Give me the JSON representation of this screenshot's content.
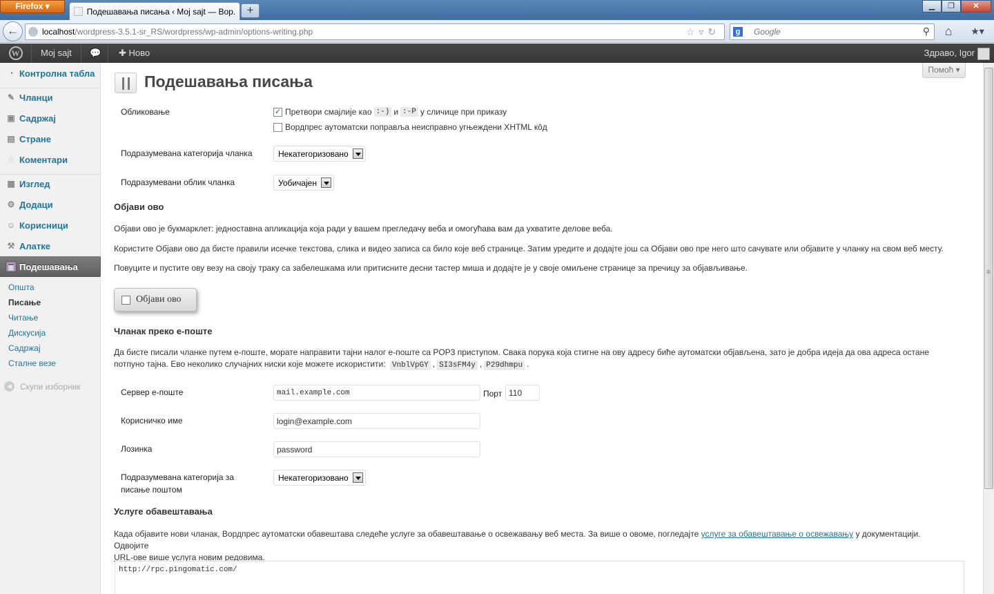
{
  "browser": {
    "app_button": "Firefox",
    "tab_title": "Подешавања писања ‹ Мој sajt — Вор...",
    "url_host": "localhost",
    "url_path": "/wordpress-3.5.1-sr_RS/wordpress/wp-admin/options-writing.php",
    "search_placeholder": "Google",
    "search_engine_letter": "g"
  },
  "adminbar": {
    "site_name": "Moj sajt",
    "new_label": "Ново",
    "howdy": "Здраво, Igor"
  },
  "sidebar": {
    "items": [
      {
        "label": "Контролна табла",
        "icon": "dashboard-icon"
      },
      {
        "label": "Чланци",
        "icon": "pin-icon"
      },
      {
        "label": "Садржај",
        "icon": "media-icon"
      },
      {
        "label": "Стране",
        "icon": "pages-icon"
      },
      {
        "label": "Коментари",
        "icon": "comment-icon"
      },
      {
        "label": "Изглед",
        "icon": "appearance-icon"
      },
      {
        "label": "Додаци",
        "icon": "plugin-icon"
      },
      {
        "label": "Корисници",
        "icon": "users-icon"
      },
      {
        "label": "Алатке",
        "icon": "tools-icon"
      },
      {
        "label": "Подешавања",
        "icon": "settings-icon"
      }
    ],
    "submenu": [
      "Општа",
      "Писање",
      "Читање",
      "Дискусија",
      "Садржај",
      "Сталне везе"
    ],
    "collapse": "Скупи изборник"
  },
  "page": {
    "help": "Помоћ",
    "title": "Подешавања писања",
    "formatting": {
      "label": "Обликовање",
      "smilies_a": "Претвори смајлије као",
      "smilies_code1": ":-)",
      "smilies_and": "и",
      "smilies_code2": ":-P",
      "smilies_b": "у сличице при приказу",
      "smilies_checked": true,
      "xhtml": "Вордпрес аутоматски поправља неисправно угњеждени XHTML кôд",
      "xhtml_checked": false
    },
    "default_category": {
      "label": "Подразумевана категорија чланка",
      "value": "Некатегоризовано"
    },
    "default_format": {
      "label": "Подразумевани облик чланка",
      "value": "Уобичајен"
    },
    "press_this": {
      "heading": "Објави ово",
      "p1": "Објави ово је букмарклет: једноставна апликација која ради у вашем прегледачу веба и омогућава вам да ухватите делове веба.",
      "p2": "Користите Објави ово да бисте правили исечке текстова, слика и видео записа са било које веб странице. Затим уредите и додајте још са Објави ово пре него што сачувате или објавите у чланку на свом веб месту.",
      "p3": "Повуците и пустите ову везу на своју траку са забелешкама или притисните десни тастер миша и додајте је у своје омиљене странице за пречицу за објављивање.",
      "button": "Објави ово"
    },
    "post_via_email": {
      "heading": "Чланак преко е-поште",
      "p_line1": "Да бисте писали чланке путем е-поште, морате направити тајни налог е-поште са POP3 приступом. Свака порука која стигне на ову адресу биће аутоматски објављена, зато је добра идеја да ова адреса остане",
      "p_line2": "потпуно тајна. Ево неколико случајних ниски које можете искористити:",
      "codes": [
        "VnblVpGY",
        "SI3sFM4y",
        "P29dhmpu"
      ],
      "server_label": "Сервер е-поште",
      "server_value": "mail.example.com",
      "port_label": "Порт",
      "port_value": "110",
      "login_label": "Корисничко име",
      "login_value": "login@example.com",
      "password_label": "Лозинка",
      "password_value": "password",
      "category_label_1": "Подразумевана категорија за",
      "category_label_2": "писање поштом",
      "category_value": "Некатегоризовано"
    },
    "update_services": {
      "heading": "Услуге обавештавања",
      "p_a": "Када објавите нови чланак, Вордпрес аутоматски обавештава следеће услуге за обавештавање о освежавању веб места. За више о овоме, погледајте",
      "p_link": "услуге за обавештавање о освежавању",
      "p_b": "у документацији. Одвојите",
      "p_c_abbr": "URL",
      "p_c": "-ове више услуга новим редовима.",
      "ping_sites": "http://rpc.pingomatic.com/"
    }
  }
}
